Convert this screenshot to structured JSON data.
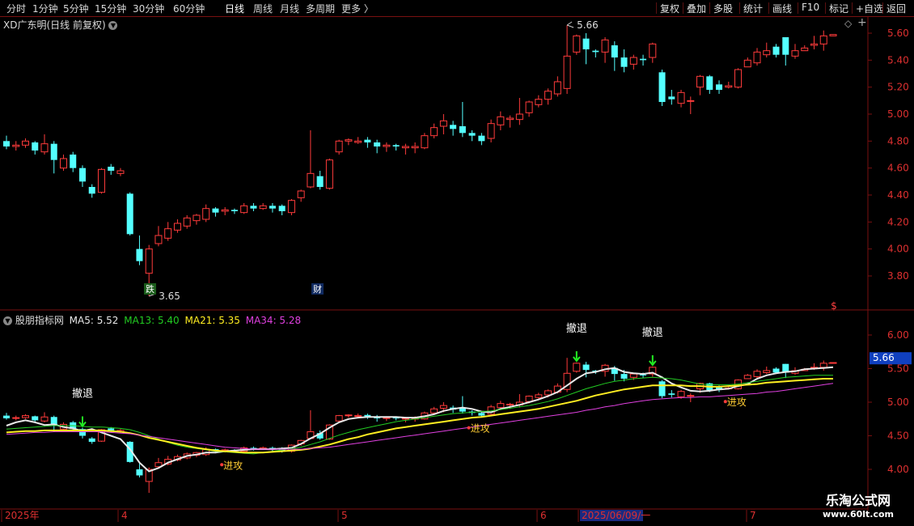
{
  "toolbar": {
    "periods": [
      "分时",
      "1分钟",
      "5分钟",
      "15分钟",
      "30分钟",
      "60分钟",
      "日线",
      "周线",
      "月线",
      "多周期",
      "更多"
    ],
    "active_period": "日线",
    "right_buttons": [
      "复权",
      "叠加",
      "多股",
      "统计",
      "画线",
      "F10",
      "标记",
      "+自选",
      "返回"
    ]
  },
  "main_header": {
    "title": "XD广东明(日线 前复权)"
  },
  "indicator_header": {
    "name": "股朋指标网",
    "ma": [
      {
        "label": "MA5: 5.52",
        "color": "#e8e8e8"
      },
      {
        "label": "MA13: 5.40",
        "color": "#22cc22"
      },
      {
        "label": "MA21: 5.35",
        "color": "#ffee22"
      },
      {
        "label": "MA34: 5.28",
        "color": "#e040e0"
      }
    ]
  },
  "annotations": {
    "high_label": "5.66",
    "low_label": "3.65",
    "tag_die": "跌",
    "tag_cai": "财",
    "tag_dollar": "$",
    "retreat": "撤退",
    "attack": "进攻",
    "price_badge": "5.66"
  },
  "x_axis": {
    "labels": [
      "2025年",
      "4",
      "5",
      "6",
      "2025/06/09/一",
      "7"
    ]
  },
  "watermark": {
    "line1": "乐淘公式网",
    "line2": "www.60lt.com"
  },
  "colors": {
    "up": "#ff3b3b",
    "down": "#54ffff",
    "ma5": "#e8e8e8",
    "ma13": "#22cc22",
    "ma21": "#ffee22",
    "ma34": "#e040e0",
    "axis": "#7a1010",
    "tick_label": "#dd3030"
  },
  "chart_data": [
    {
      "type": "candlestick",
      "title": "XD广东明(日线 前复权)",
      "y_ticks": [
        3.8,
        4.0,
        4.2,
        4.4,
        4.6,
        4.8,
        5.0,
        5.2,
        5.4,
        5.6
      ],
      "ylim": [
        3.62,
        5.72
      ],
      "grid": false,
      "candles": [
        [
          4.8,
          4.76,
          4.84,
          4.74
        ],
        [
          4.76,
          4.77,
          4.8,
          4.73
        ],
        [
          4.77,
          4.8,
          4.82,
          4.75
        ],
        [
          4.79,
          4.73,
          4.8,
          4.7
        ],
        [
          4.72,
          4.78,
          4.85,
          4.7
        ],
        [
          4.78,
          4.66,
          4.8,
          4.56
        ],
        [
          4.6,
          4.67,
          4.7,
          4.58
        ],
        [
          4.7,
          4.6,
          4.72,
          4.57
        ],
        [
          4.6,
          4.5,
          4.62,
          4.46
        ],
        [
          4.46,
          4.41,
          4.48,
          4.38
        ],
        [
          4.42,
          4.59,
          4.6,
          4.41
        ],
        [
          4.61,
          4.58,
          4.63,
          4.55
        ],
        [
          4.56,
          4.58,
          4.6,
          4.54
        ],
        [
          4.41,
          4.11,
          4.42,
          4.1
        ],
        [
          4.0,
          3.91,
          4.1,
          3.88
        ],
        [
          3.82,
          4.0,
          4.03,
          3.65
        ],
        [
          4.04,
          4.1,
          4.17,
          4.02
        ],
        [
          4.08,
          4.15,
          4.2,
          4.06
        ],
        [
          4.14,
          4.19,
          4.22,
          4.12
        ],
        [
          4.17,
          4.23,
          4.25,
          4.15
        ],
        [
          4.21,
          4.25,
          4.26,
          4.18
        ],
        [
          4.22,
          4.3,
          4.33,
          4.2
        ],
        [
          4.3,
          4.27,
          4.31,
          4.24
        ],
        [
          4.28,
          4.29,
          4.31,
          4.25
        ],
        [
          4.29,
          4.28,
          4.3,
          4.26
        ],
        [
          4.27,
          4.32,
          4.34,
          4.26
        ],
        [
          4.32,
          4.3,
          4.34,
          4.28
        ],
        [
          4.3,
          4.32,
          4.34,
          4.29
        ],
        [
          4.32,
          4.3,
          4.34,
          4.27
        ],
        [
          4.32,
          4.28,
          4.33,
          4.25
        ],
        [
          4.27,
          4.36,
          4.37,
          4.25
        ],
        [
          4.38,
          4.43,
          4.44,
          4.35
        ],
        [
          4.46,
          4.56,
          4.88,
          4.45
        ],
        [
          4.54,
          4.46,
          4.58,
          4.44
        ],
        [
          4.45,
          4.66,
          4.67,
          4.44
        ],
        [
          4.72,
          4.8,
          4.81,
          4.7
        ],
        [
          4.8,
          4.81,
          4.82,
          4.77
        ],
        [
          4.79,
          4.8,
          4.83,
          4.78
        ],
        [
          4.81,
          4.79,
          4.83,
          4.75
        ],
        [
          4.79,
          4.76,
          4.81,
          4.71
        ],
        [
          4.76,
          4.77,
          4.79,
          4.72
        ],
        [
          4.77,
          4.76,
          4.78,
          4.73
        ],
        [
          4.75,
          4.76,
          4.78,
          4.7
        ],
        [
          4.75,
          4.76,
          4.79,
          4.71
        ],
        [
          4.75,
          4.84,
          4.86,
          4.74
        ],
        [
          4.84,
          4.9,
          4.93,
          4.82
        ],
        [
          4.91,
          4.95,
          5.0,
          4.85
        ],
        [
          4.92,
          4.89,
          4.95,
          4.84
        ],
        [
          4.91,
          4.86,
          5.09,
          4.83
        ],
        [
          4.86,
          4.84,
          4.88,
          4.8
        ],
        [
          4.84,
          4.8,
          4.86,
          4.77
        ],
        [
          4.82,
          4.93,
          4.96,
          4.79
        ],
        [
          4.92,
          4.98,
          5.02,
          4.88
        ],
        [
          4.96,
          4.97,
          4.99,
          4.9
        ],
        [
          4.96,
          5.0,
          5.12,
          4.92
        ],
        [
          5.01,
          5.09,
          5.1,
          4.98
        ],
        [
          5.07,
          5.11,
          5.14,
          5.05
        ],
        [
          5.11,
          5.17,
          5.19,
          5.07
        ],
        [
          5.15,
          5.24,
          5.28,
          5.13
        ],
        [
          5.19,
          5.43,
          5.66,
          5.15
        ],
        [
          5.46,
          5.58,
          5.59,
          5.44
        ],
        [
          5.56,
          5.48,
          5.6,
          5.37
        ],
        [
          5.47,
          5.46,
          5.48,
          5.42
        ],
        [
          5.46,
          5.55,
          5.57,
          5.38
        ],
        [
          5.51,
          5.42,
          5.54,
          5.32
        ],
        [
          5.42,
          5.35,
          5.48,
          5.31
        ],
        [
          5.37,
          5.42,
          5.44,
          5.33
        ],
        [
          5.41,
          5.4,
          5.44,
          5.36
        ],
        [
          5.42,
          5.52,
          5.53,
          5.38
        ],
        [
          5.31,
          5.09,
          5.33,
          5.06
        ],
        [
          5.13,
          5.11,
          5.18,
          5.07
        ],
        [
          5.08,
          5.16,
          5.18,
          5.05
        ],
        [
          5.1,
          5.1,
          5.13,
          5.0
        ],
        [
          5.2,
          5.28,
          5.29,
          5.14
        ],
        [
          5.28,
          5.18,
          5.29,
          5.15
        ],
        [
          5.22,
          5.18,
          5.25,
          5.15
        ],
        [
          5.2,
          5.21,
          5.24,
          5.19
        ],
        [
          5.2,
          5.33,
          5.34,
          5.19
        ],
        [
          5.35,
          5.4,
          5.42,
          5.36
        ],
        [
          5.38,
          5.46,
          5.49,
          5.36
        ],
        [
          5.44,
          5.47,
          5.53,
          5.42
        ],
        [
          5.5,
          5.44,
          5.52,
          5.42
        ],
        [
          5.57,
          5.44,
          5.57,
          5.36
        ],
        [
          5.43,
          5.47,
          5.52,
          5.41
        ],
        [
          5.47,
          5.49,
          5.51,
          5.47
        ],
        [
          5.51,
          5.52,
          5.58,
          5.48
        ],
        [
          5.52,
          5.58,
          5.62,
          5.47
        ],
        [
          5.58,
          5.59,
          5.59,
          5.58
        ]
      ]
    },
    {
      "type": "line",
      "title": "股朋指标网",
      "y_ticks": [
        4.0,
        4.5,
        5.0,
        5.5,
        6.0
      ],
      "ylim": [
        3.85,
        6.2
      ],
      "series": [
        {
          "name": "MA5",
          "values": [
            4.65,
            4.7,
            4.73,
            4.7,
            4.66,
            4.67,
            4.63,
            4.61,
            4.57,
            4.6,
            4.55,
            4.5,
            4.45,
            4.3,
            4.1,
            3.97,
            4.02,
            4.1,
            4.15,
            4.2,
            4.22,
            4.25,
            4.25,
            4.27,
            4.28,
            4.29,
            4.3,
            4.3,
            4.3,
            4.31,
            4.32,
            4.38,
            4.46,
            4.53,
            4.62,
            4.7,
            4.75,
            4.77,
            4.78,
            4.78,
            4.78,
            4.78,
            4.77,
            4.77,
            4.79,
            4.82,
            4.87,
            4.9,
            4.92,
            4.9,
            4.86,
            4.85,
            4.9,
            4.93,
            4.96,
            5.0,
            5.04,
            5.09,
            5.15,
            5.25,
            5.35,
            5.43,
            5.45,
            5.49,
            5.51,
            5.45,
            5.43,
            5.42,
            5.44,
            5.37,
            5.28,
            5.22,
            5.17,
            5.16,
            5.17,
            5.19,
            5.2,
            5.24,
            5.27,
            5.35,
            5.4,
            5.43,
            5.45,
            5.46,
            5.49,
            5.5,
            5.51,
            5.52
          ]
        },
        {
          "name": "MA13",
          "values": [
            4.6,
            4.61,
            4.62,
            4.63,
            4.64,
            4.65,
            4.65,
            4.65,
            4.64,
            4.63,
            4.63,
            4.62,
            4.61,
            4.59,
            4.55,
            4.5,
            4.45,
            4.4,
            4.36,
            4.33,
            4.31,
            4.29,
            4.27,
            4.26,
            4.25,
            4.24,
            4.23,
            4.25,
            4.27,
            4.29,
            4.31,
            4.33,
            4.37,
            4.41,
            4.46,
            4.51,
            4.55,
            4.59,
            4.62,
            4.65,
            4.68,
            4.71,
            4.73,
            4.75,
            4.77,
            4.79,
            4.81,
            4.83,
            4.84,
            4.85,
            4.86,
            4.87,
            4.89,
            4.91,
            4.93,
            4.95,
            4.98,
            5.01,
            5.05,
            5.1,
            5.15,
            5.2,
            5.24,
            5.28,
            5.31,
            5.33,
            5.35,
            5.36,
            5.37,
            5.36,
            5.35,
            5.33,
            5.3,
            5.27,
            5.26,
            5.26,
            5.26,
            5.27,
            5.29,
            5.31,
            5.33,
            5.35,
            5.37,
            5.38,
            5.39,
            5.4,
            5.4,
            5.4
          ]
        },
        {
          "name": "MA21",
          "values": [
            4.55,
            4.56,
            4.57,
            4.57,
            4.58,
            4.58,
            4.58,
            4.58,
            4.58,
            4.58,
            4.58,
            4.57,
            4.56,
            4.54,
            4.51,
            4.47,
            4.44,
            4.41,
            4.38,
            4.35,
            4.32,
            4.3,
            4.28,
            4.27,
            4.26,
            4.25,
            4.25,
            4.25,
            4.26,
            4.27,
            4.28,
            4.29,
            4.31,
            4.34,
            4.37,
            4.41,
            4.45,
            4.48,
            4.52,
            4.55,
            4.58,
            4.61,
            4.63,
            4.65,
            4.67,
            4.69,
            4.71,
            4.73,
            4.75,
            4.77,
            4.78,
            4.8,
            4.82,
            4.84,
            4.86,
            4.88,
            4.9,
            4.93,
            4.96,
            4.99,
            5.02,
            5.06,
            5.1,
            5.13,
            5.16,
            5.19,
            5.21,
            5.23,
            5.25,
            5.25,
            5.25,
            5.25,
            5.24,
            5.24,
            5.23,
            5.23,
            5.24,
            5.25,
            5.26,
            5.27,
            5.29,
            5.3,
            5.31,
            5.32,
            5.33,
            5.34,
            5.35,
            5.35
          ]
        },
        {
          "name": "MA34",
          "values": [
            4.52,
            4.53,
            4.54,
            4.55,
            4.55,
            4.56,
            4.56,
            4.56,
            4.56,
            4.56,
            4.56,
            4.55,
            4.54,
            4.53,
            4.51,
            4.49,
            4.47,
            4.45,
            4.43,
            4.41,
            4.39,
            4.37,
            4.35,
            4.33,
            4.32,
            4.31,
            4.3,
            4.3,
            4.3,
            4.3,
            4.3,
            4.3,
            4.31,
            4.32,
            4.33,
            4.35,
            4.37,
            4.39,
            4.41,
            4.43,
            4.45,
            4.47,
            4.49,
            4.51,
            4.53,
            4.55,
            4.57,
            4.59,
            4.61,
            4.63,
            4.65,
            4.67,
            4.69,
            4.71,
            4.73,
            4.75,
            4.77,
            4.79,
            4.81,
            4.83,
            4.85,
            4.88,
            4.9,
            4.93,
            4.95,
            4.98,
            5.0,
            5.02,
            5.04,
            5.05,
            5.06,
            5.07,
            5.07,
            5.08,
            5.08,
            5.09,
            5.1,
            5.11,
            5.12,
            5.13,
            5.15,
            5.16,
            5.18,
            5.2,
            5.22,
            5.24,
            5.26,
            5.28
          ]
        }
      ],
      "retreat_at": [
        8,
        60,
        68
      ],
      "attack_at": [
        23,
        49,
        76
      ]
    }
  ]
}
